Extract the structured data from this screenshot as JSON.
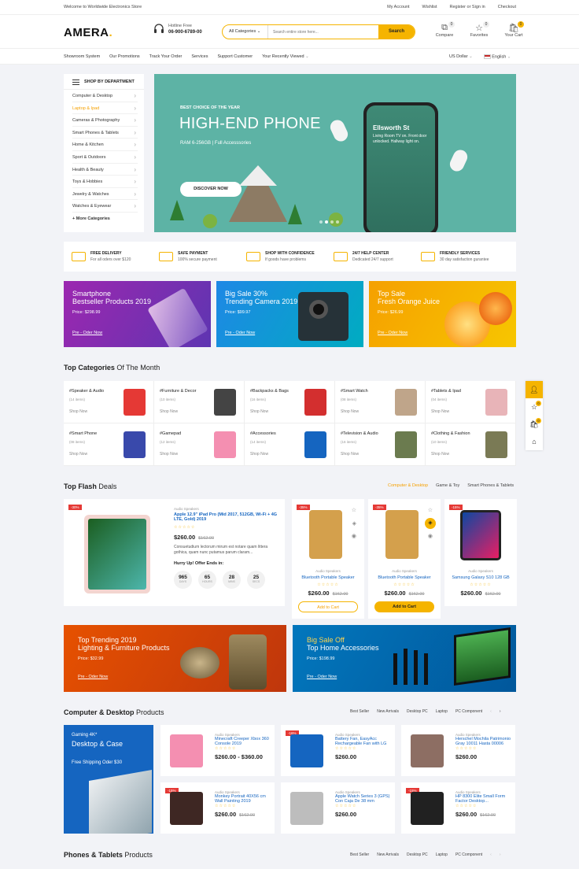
{
  "topbar": {
    "welcome": "Welcome to Worldwide Electronics Store",
    "links": [
      "My Account",
      "Wishlist",
      "Register or Sign in",
      "Checkout"
    ]
  },
  "header": {
    "logo": "AMERA",
    "logo_dot": ".",
    "hotline_label": "Hotline Free",
    "hotline_number": "06-900-6789-00",
    "search_category": "All Categories",
    "search_placeholder": "Search entire store here...",
    "search_button": "Search",
    "compare": "Compare",
    "compare_count": "0",
    "favorites": "Favorites",
    "favorites_count": "0",
    "cart": "Your Cart",
    "cart_count": "0"
  },
  "nav": {
    "items": [
      "Showroom System",
      "Our Promotions",
      "Track Your Order",
      "Services",
      "Support Customer",
      "Your Recently Viewed"
    ],
    "currency": "US Dollar",
    "language": "English"
  },
  "sidebar": {
    "title": "SHOP BY DEPARTMENT",
    "items": [
      "Computer & Desktop",
      "Laptop & Ipad",
      "Cameras & Photography",
      "Smart Phones & Tablets",
      "Home & Kitchen",
      "Sport & Outdoors",
      "Health & Beauty",
      "Toys & Hobbies",
      "Jewelry & Watches",
      "Watches & Eyewear"
    ],
    "more": "+ More Categories"
  },
  "hero": {
    "kicker": "BEST CHOICE OF THE YEAR",
    "title": "HIGH-END PHONE",
    "subtitle": "RAM 6-256GB | Full Accesssories",
    "cta": "DISCOVER NOW",
    "phone_title": "Ellsworth St",
    "phone_text": "Living Room TV on. Front door unlocked. Hallway light on."
  },
  "services": [
    {
      "t1": "FREE DELIVERY",
      "t2": "For all oders over $120"
    },
    {
      "t1": "SAFE PAYMENT",
      "t2": "100% secure payment"
    },
    {
      "t1": "SHOP WITH CONFIDENCE",
      "t2": "If goods have problems"
    },
    {
      "t1": "24/7 HELP CENTER",
      "t2": "Dedicated 24/7 support"
    },
    {
      "t1": "FRIENDLY SERVICES",
      "t2": "30 day satisfaction gurantee"
    }
  ],
  "promos": [
    {
      "title1": "Smartphone",
      "title2": "Bestseller Products 2019",
      "price": "Price: $298.99",
      "cta": "Pre - Oder Now",
      "color": "#8e2bd8"
    },
    {
      "title1": "Big Sale 30%",
      "title2": "Trending Camera 2019",
      "price": "Price: $99.97",
      "cta": "Pre - Oder Now",
      "color": "#1e88e5"
    },
    {
      "title1": "Top Sale",
      "title2": "Fresh Orange Juice",
      "price": "Price: $26.99",
      "cta": "Pre - Oder Now",
      "color": "#f5a000"
    }
  ],
  "top_categories": {
    "title_bold": "Top Categories",
    "title_rest": " Of The Month",
    "shop": "Shop Now",
    "items": [
      {
        "name": "#Speaker & Audio",
        "count": "(14 items)",
        "color": "#e53935"
      },
      {
        "name": "#Furniture & Decor",
        "count": "(10 items)",
        "color": "#444"
      },
      {
        "name": "#Backpacks & Bags",
        "count": "(16 items)",
        "color": "#d32f2f"
      },
      {
        "name": "#Smart Watch",
        "count": "(08 items)",
        "color": "#bfa58a"
      },
      {
        "name": "#Tablets & Ipad",
        "count": "(04 items)",
        "color": "#e8b4b8"
      },
      {
        "name": "#Smart Phone",
        "count": "(08 items)",
        "color": "#3949ab"
      },
      {
        "name": "#Gamepad",
        "count": "(12 items)",
        "color": "#f48fb1"
      },
      {
        "name": "#Accessories",
        "count": "(14 items)",
        "color": "#1565c0"
      },
      {
        "name": "#Television & Audio",
        "count": "(16 items)",
        "color": "#6b7b4f"
      },
      {
        "name": "#Clothing & Fashion",
        "count": "(10 items)",
        "color": "#7a7a55"
      }
    ]
  },
  "flash": {
    "title_bold": "Top Flash",
    "title_rest": " Deals",
    "tabs": [
      "Computer & Desktop",
      "Game & Toy",
      "Smart Phones & Tablets"
    ],
    "big": {
      "badge": "-30%",
      "type": "Audio Speakers",
      "name": "Apple 12.9\" iPad Pro (Mid 2017, 512GB, Wi-Fi + 4G LTE, Gold) 2019",
      "stars": "☆☆☆☆☆",
      "price": "$260.00",
      "old": "$162.00",
      "desc": "Consuetudium lectorum mirum est notare quam littera gothica, quam nunc putamus parum claram...",
      "hurry": "Hurry Up! Offer Ends in:",
      "countdown": [
        {
          "v": "965",
          "l": "DAYS"
        },
        {
          "v": "65",
          "l": "HOURS"
        },
        {
          "v": "28",
          "l": "MINS"
        },
        {
          "v": "25",
          "l": "SECS"
        }
      ]
    },
    "small": [
      {
        "badge": "-35%",
        "type": "Audio Speakers",
        "name": "Bluetooth Portable Speaker",
        "stars": "☆☆☆☆☆",
        "price": "$260.00",
        "old": "$162.00",
        "cta": "Add to Cart"
      },
      {
        "badge": "-35%",
        "type": "Audio Speakers",
        "name": "Bluetooth Portable Speaker",
        "stars": "☆☆☆☆☆",
        "price": "$260.00",
        "old": "$162.00",
        "cta": "Add to Cart"
      },
      {
        "badge": "-15%",
        "type": "Audio Speakers",
        "name": "Samsung Galaxy S10 128 GB",
        "stars": "☆☆☆☆☆",
        "price": "$260.00",
        "old": "$162.00"
      }
    ]
  },
  "banners": [
    {
      "t1": "Top Trending 2019",
      "t2": "Lighting & Furniture Products",
      "price": "Price: $32.99",
      "cta": "Pre - Oder Now"
    },
    {
      "t1": "Big Sale Off",
      "t2": "Top Home Accessories",
      "price": "Price: $198.99",
      "cta": "Pre - Oder Now"
    }
  ],
  "computer": {
    "title_bold": "Computer & Desktop",
    "title_rest": " Products",
    "tabs": [
      "Best Seller",
      "New Arrivals",
      "Desktop PC",
      "Laptop",
      "PC Component"
    ],
    "banner": {
      "t1": "Gaming 4K*",
      "t2": "Desktop & Case",
      "t3": "Free Shipping Oder $30"
    },
    "products": [
      {
        "badge": "",
        "type": "Audio Speakers",
        "name": "Minecraft Creeper Xbox 360 Console 2019",
        "stars": "☆☆☆☆☆",
        "price": "$260.00 - $360.00",
        "old": "",
        "color": "#f48fb1"
      },
      {
        "badge": "-16%",
        "type": "Audio Speakers",
        "name": "Battery Fan, EasyAcc Rechargeable Fan with LG",
        "stars": "☆☆☆☆☆",
        "price": "$260.00",
        "old": "",
        "color": "#1565c0"
      },
      {
        "badge": "",
        "type": "Audio Speakers",
        "name": "Herschel Mochila Patrimonio Gray 10011 Hasta 00006",
        "stars": "☆☆☆☆☆",
        "price": "$260.00",
        "old": "",
        "color": "#8d6e63"
      },
      {
        "badge": "-15%",
        "type": "Audio Speakers",
        "name": "Monkey Portrait 40X56 cm Wall Painting 2019",
        "stars": "☆☆☆☆☆",
        "price": "$260.00",
        "old": "$162.00",
        "color": "#3e2723"
      },
      {
        "badge": "",
        "type": "Audio Speakers",
        "name": "Apple Watch Series 3 (GPS) Con Caja De 38 mm",
        "stars": "☆☆☆☆☆",
        "price": "$260.00",
        "old": "",
        "color": "#bdbdbd"
      },
      {
        "badge": "-15%",
        "type": "Audio Speakers",
        "name": "HP 8300 Elite Small Form Factor Desktop...",
        "stars": "☆☆☆☆☆",
        "price": "$260.00",
        "old": "$162.00",
        "color": "#212121"
      }
    ]
  },
  "phones": {
    "title_bold": "Phones & Tablets",
    "title_rest": " Products",
    "tabs": [
      "Best Seller",
      "New Arrivals",
      "Desktop PC",
      "Laptop",
      "PC Component"
    ]
  },
  "floating": {
    "compare_count": "0",
    "cart_count": "0"
  }
}
